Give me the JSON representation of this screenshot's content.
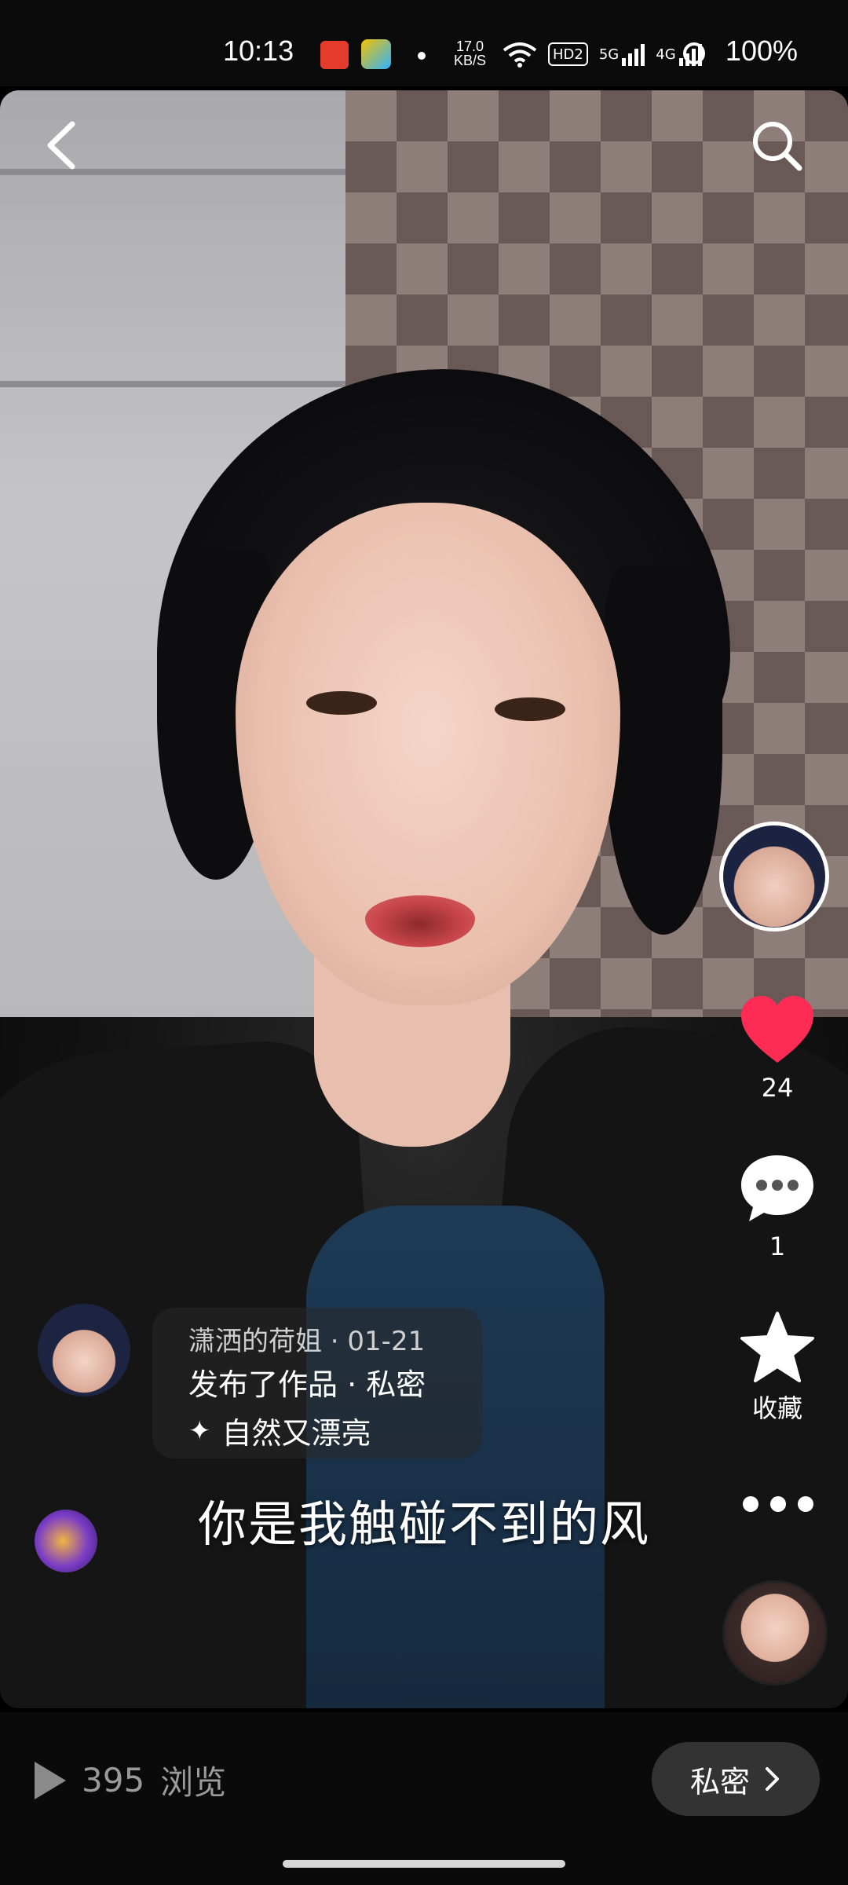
{
  "status_bar": {
    "time": "10:13",
    "network_speed_top": "17.0",
    "network_speed_unit": "KB/S",
    "hd_label": "HD2",
    "signal_5g": "5G",
    "signal_4g": "4G",
    "battery": "100%"
  },
  "top_bar": {
    "back_icon": "back-chevron-icon",
    "search_icon": "search-icon"
  },
  "right_rail": {
    "like_count": "24",
    "comment_count": "1",
    "favorite_label": "收藏"
  },
  "post": {
    "meta": "潇洒的荷姐 · 01-21",
    "action": "发布了作品 · 私密",
    "effect_icon": "✦",
    "effect": "自然又漂亮"
  },
  "subtitle": "你是我触碰不到的风",
  "bottom": {
    "views_count": "395",
    "views_label": "浏览",
    "privacy_label": "私密"
  },
  "colors": {
    "like": "#fe2c55",
    "background": "#000000",
    "privacy_button": "#333333"
  }
}
